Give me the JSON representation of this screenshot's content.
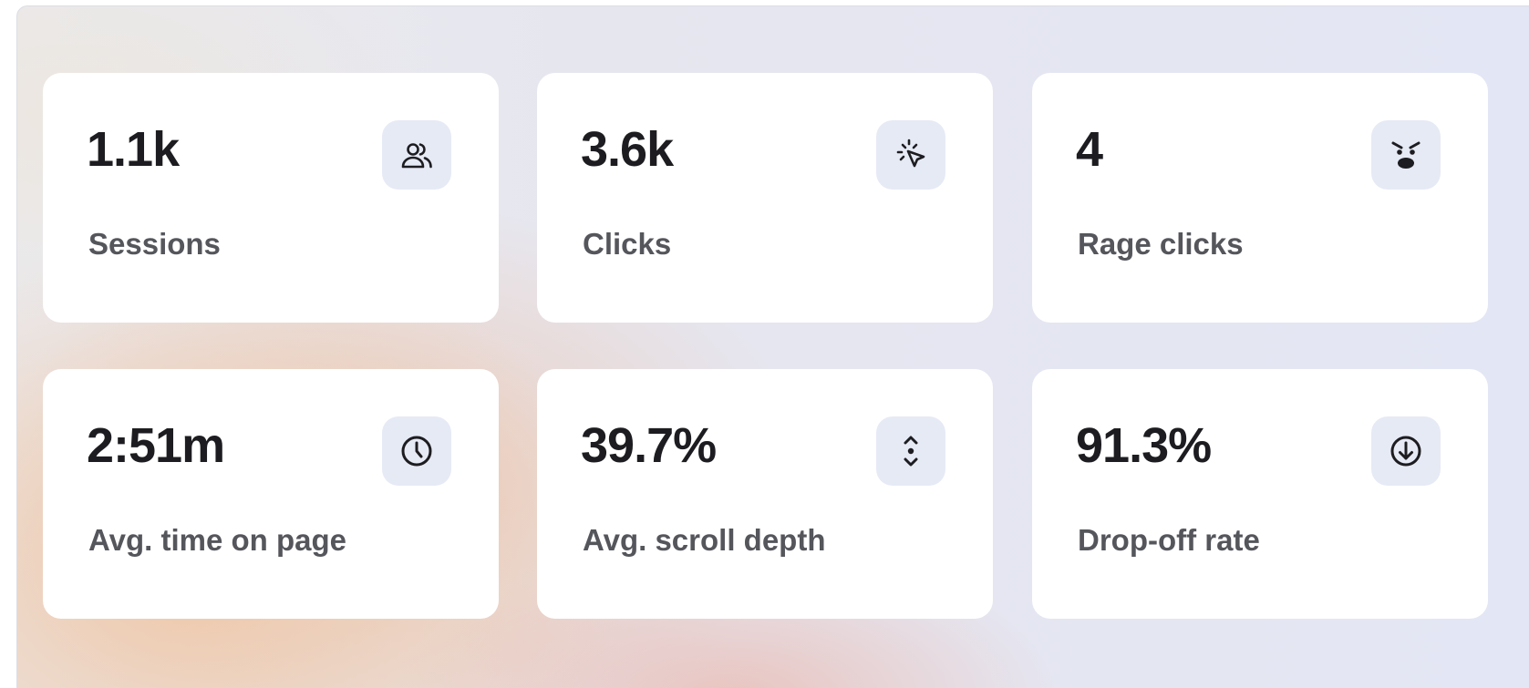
{
  "metrics": [
    {
      "value": "1.1k",
      "label": "Sessions",
      "icon": "users-icon"
    },
    {
      "value": "3.6k",
      "label": "Clicks",
      "icon": "cursor-click-icon"
    },
    {
      "value": "4",
      "label": "Rage clicks",
      "icon": "angry-face-icon"
    },
    {
      "value": "2:51m",
      "label": "Avg. time on page",
      "icon": "clock-icon"
    },
    {
      "value": "39.7%",
      "label": "Avg. scroll depth",
      "icon": "scroll-icon"
    },
    {
      "value": "91.3%",
      "label": "Drop-off rate",
      "icon": "arrow-down-circle-icon"
    }
  ]
}
